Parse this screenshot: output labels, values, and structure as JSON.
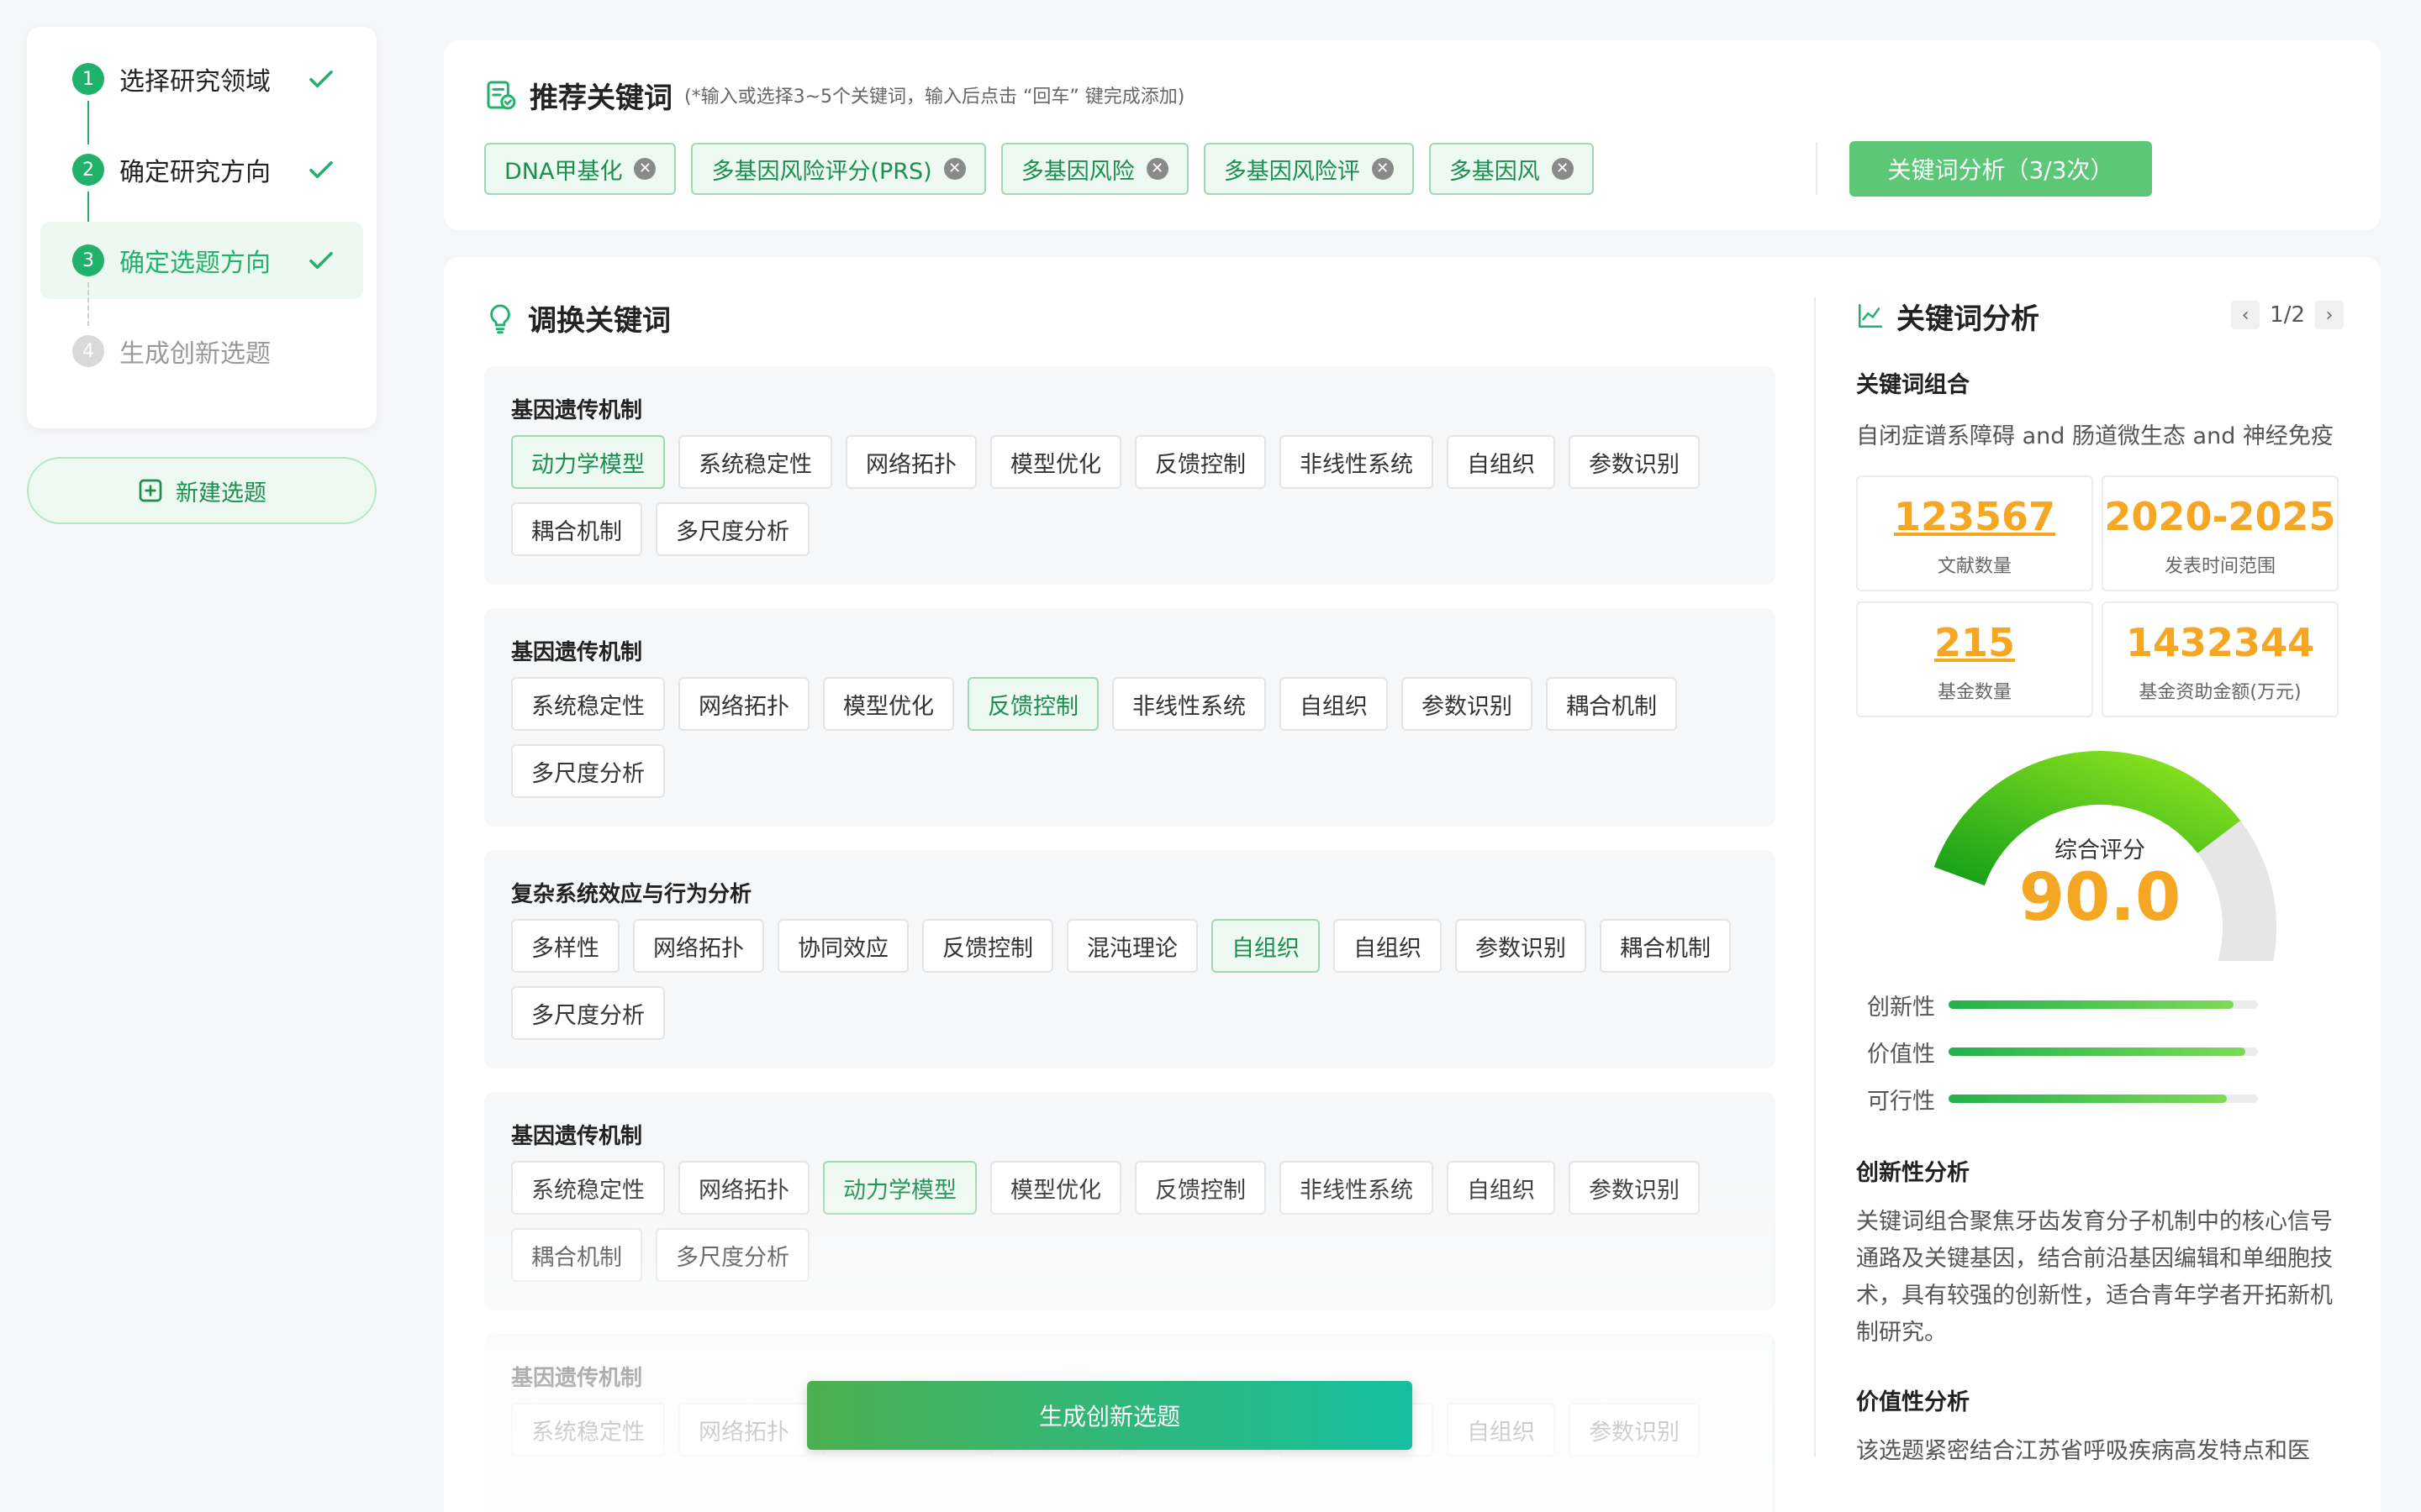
{
  "sidebar": {
    "steps": [
      {
        "num": "1",
        "label": "选择研究领域"
      },
      {
        "num": "2",
        "label": "确定研究方向"
      },
      {
        "num": "3",
        "label": "确定选题方向"
      },
      {
        "num": "4",
        "label": "生成创新选题"
      }
    ],
    "new_topic_label": "新建选题"
  },
  "keywords": {
    "title": "推荐关键词",
    "hint": "(*输入或选择3~5个关键词，输入后点击 “回车” 键完成添加)",
    "tags": [
      "DNA甲基化",
      "多基因风险评分(PRS)",
      "多基因风险",
      "多基因风险评",
      "多基因风"
    ],
    "analyze_button": "关键词分析（3/3次）"
  },
  "swap": {
    "title": "调换关键词",
    "groups": [
      {
        "title": "基因遗传机制",
        "chips": [
          "动力学模型",
          "系统稳定性",
          "网络拓扑",
          "模型优化",
          "反馈控制",
          "非线性系统",
          "自组织",
          "参数识别",
          "耦合机制",
          "多尺度分析"
        ],
        "selected": 0
      },
      {
        "title": "基因遗传机制",
        "chips": [
          "系统稳定性",
          "网络拓扑",
          "模型优化",
          "反馈控制",
          "非线性系统",
          "自组织",
          "参数识别",
          "耦合机制",
          "多尺度分析"
        ],
        "selected": 3
      },
      {
        "title": "复杂系统效应与行为分析",
        "chips": [
          "多样性",
          "网络拓扑",
          "协同效应",
          "反馈控制",
          "混沌理论",
          "自组织",
          "自组织",
          "参数识别",
          "耦合机制",
          "多尺度分析"
        ],
        "selected": 5
      },
      {
        "title": "基因遗传机制",
        "chips": [
          "系统稳定性",
          "网络拓扑",
          "动力学模型",
          "模型优化",
          "反馈控制",
          "非线性系统",
          "自组织",
          "参数识别",
          "耦合机制",
          "多尺度分析"
        ],
        "selected": 2
      },
      {
        "title": "基因遗传机制",
        "chips": [
          "系统稳定性",
          "网络拓扑",
          "动力学模型",
          "模型优化",
          "反馈控制",
          "非线性系统",
          "自组织",
          "参数识别"
        ],
        "selected": -1
      }
    ],
    "generate_button": "生成创新选题"
  },
  "analysis": {
    "title": "关键词分析",
    "pager": "1/2",
    "combo_label": "关键词组合",
    "combo_text": "自闭症谱系障碍 and 肠道微生态 and 神经免疫",
    "stats": [
      {
        "value": "123567",
        "caption": "文献数量"
      },
      {
        "value": "2020-2025",
        "caption": "发表时间范围"
      },
      {
        "value": "215",
        "caption": "基金数量"
      },
      {
        "value": "1432344",
        "caption": "基金资助金额(万元)"
      }
    ],
    "score_label": "综合评分",
    "score_value": "90.0",
    "score_fraction": 0.9,
    "bars": [
      {
        "label": "创新性",
        "fraction": 0.92
      },
      {
        "label": "价值性",
        "fraction": 0.96
      },
      {
        "label": "可行性",
        "fraction": 0.9
      }
    ],
    "innovation_title": "创新性分析",
    "innovation_text": "关键词组合聚焦牙齿发育分子机制中的核心信号通路及关键基因，结合前沿基因编辑和单细胞技术，具有较强的创新性，适合青年学者开拓新机制研究。",
    "value_title": "价值性分析",
    "value_text": "该选题紧密结合江苏省呼吸疾病高发特点和医"
  },
  "colors": {
    "accent": "#20b26b",
    "score": "#f5a623"
  }
}
